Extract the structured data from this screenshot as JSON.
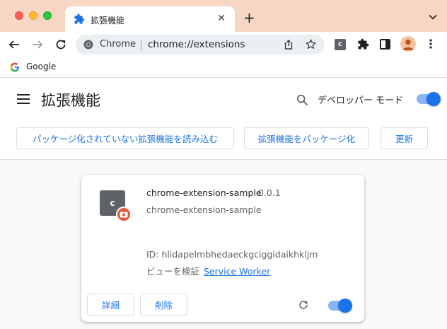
{
  "browser": {
    "tab": {
      "title": "拡張機能",
      "icon": "puzzle-icon"
    },
    "omnibox": {
      "chip": "Chrome",
      "url": "chrome://extensions"
    },
    "extension_letter": "c",
    "bookmarks": [
      {
        "label": "Google",
        "icon": "google-g-icon"
      }
    ],
    "colors": {
      "tabstrip": "#f7d6c4",
      "accent": "#1a73e8"
    }
  },
  "header": {
    "title": "拡張機能",
    "dev_mode_label": "デベロッパー モード",
    "dev_mode_on": true,
    "buttons": {
      "load_unpacked": "パッケージ化されていない拡張機能を読み込む",
      "pack": "拡張機能をパッケージ化",
      "update": "更新"
    }
  },
  "extension": {
    "icon_letter": "c",
    "name": "chrome-extension-sample",
    "version": "0.0.1",
    "description": "chrome-extension-sample",
    "id_line": "ID: hlidapelmbhedaeckgciggidaikhkljm",
    "inspect_label": "ビューを検証",
    "inspect_link": "Service Worker",
    "details_label": "詳細",
    "remove_label": "削除",
    "enabled": true
  }
}
